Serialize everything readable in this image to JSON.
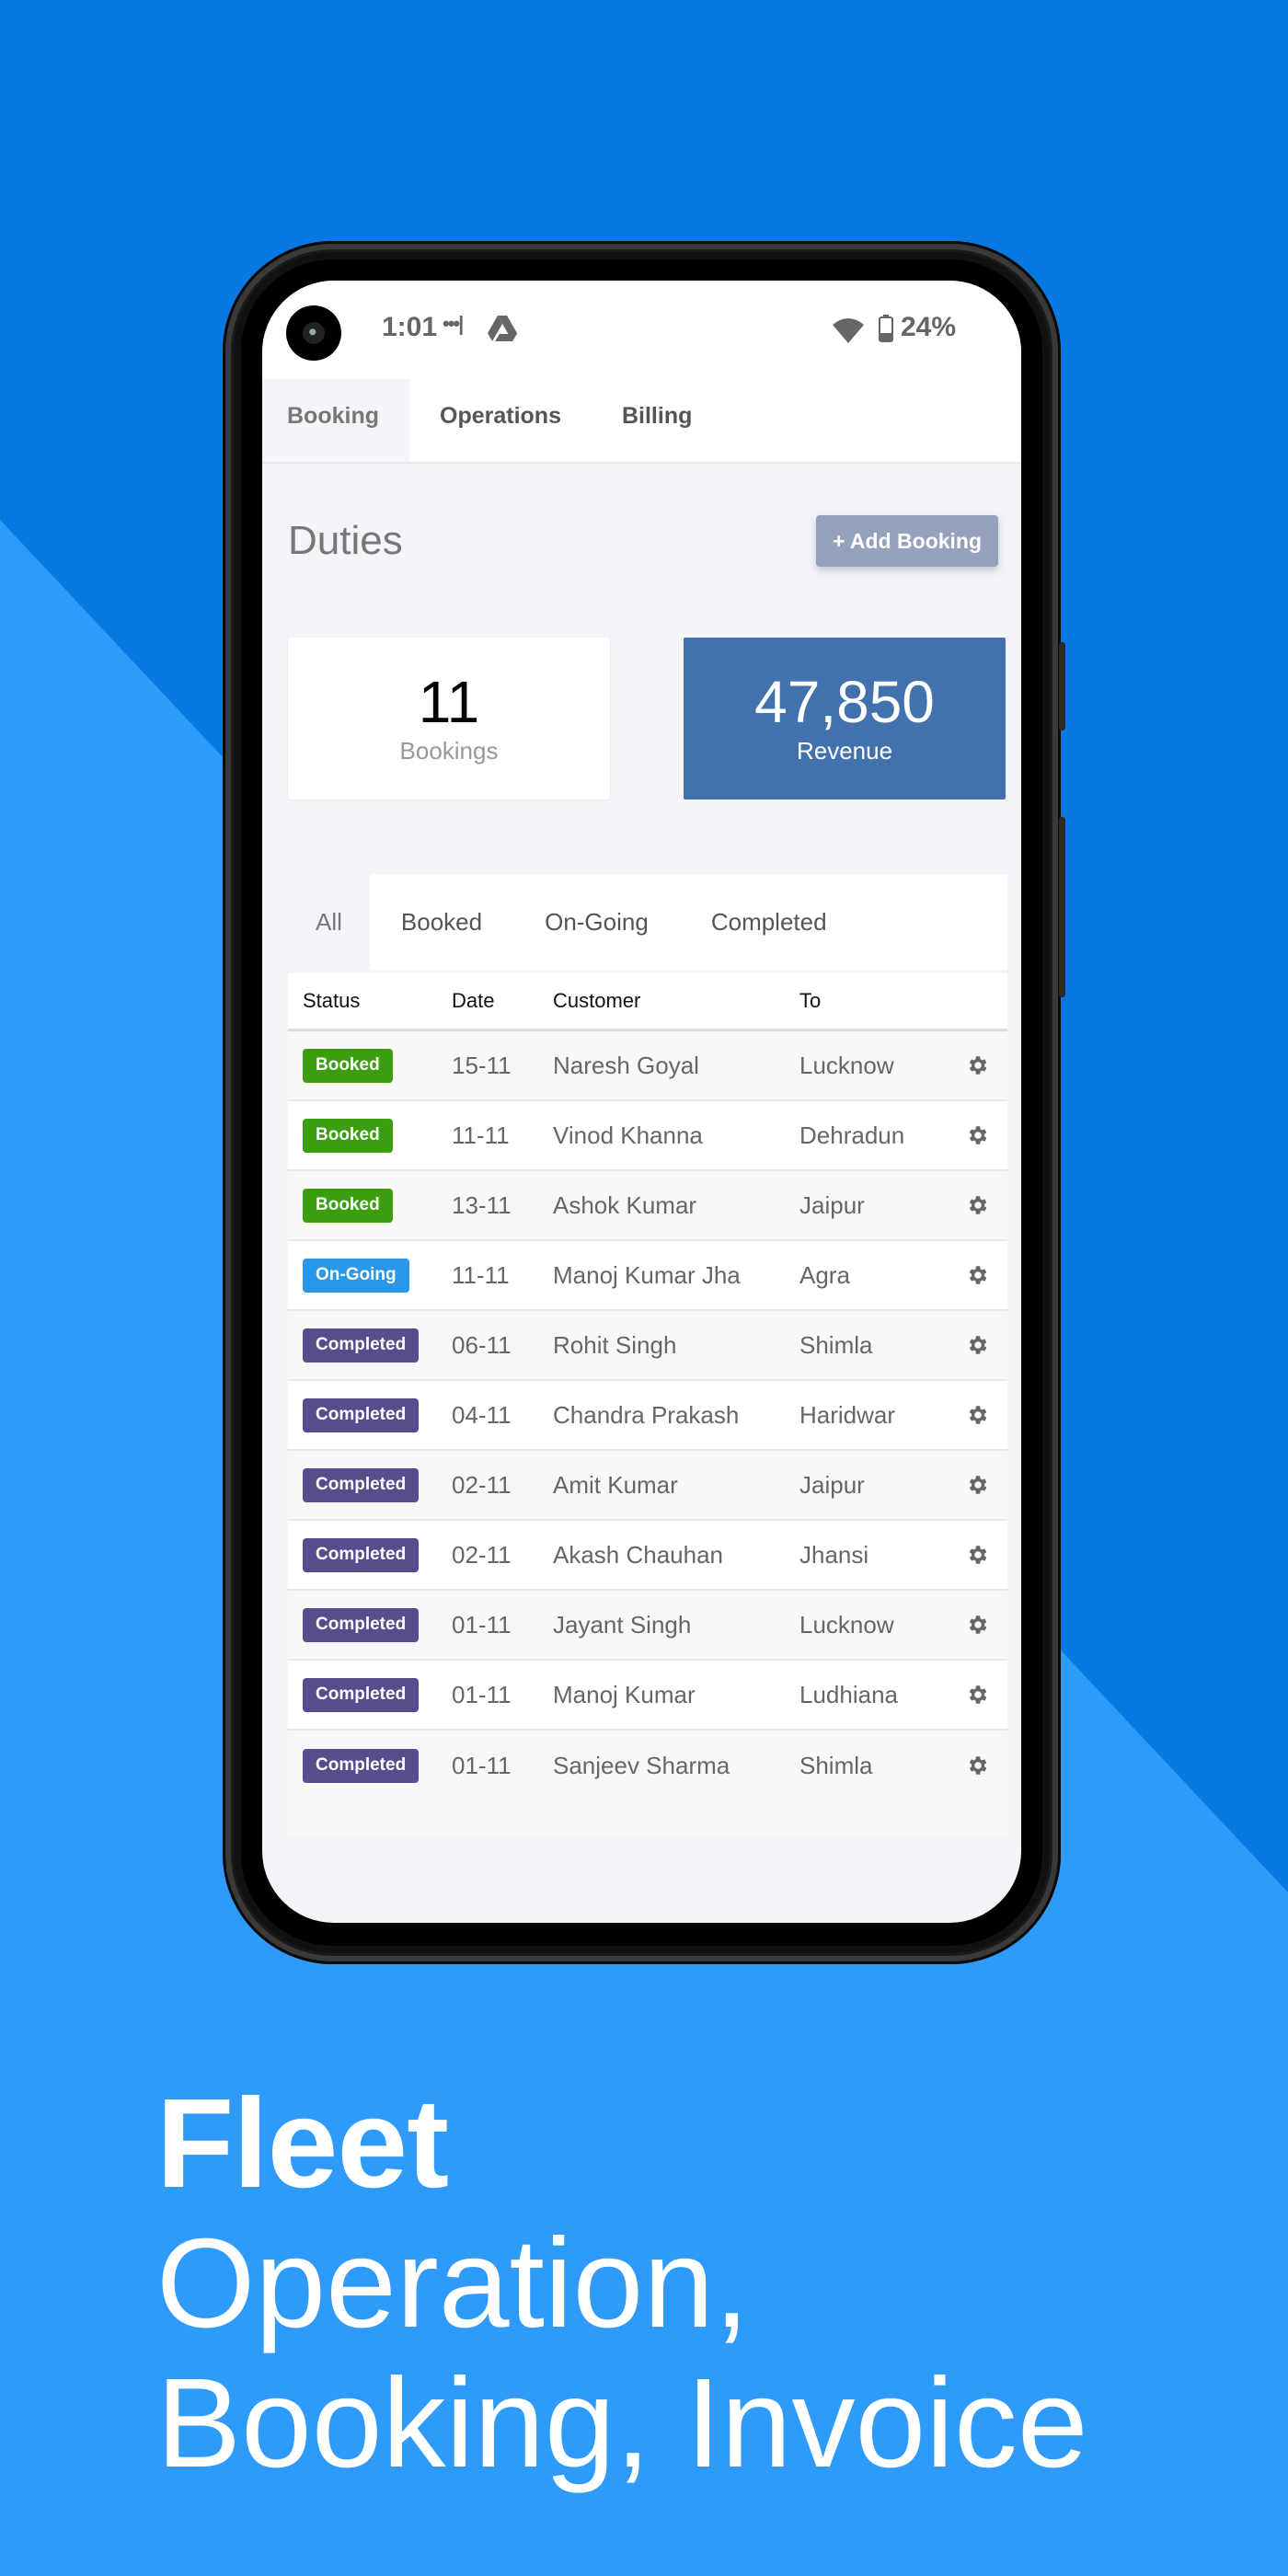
{
  "status_bar": {
    "time": "1:01",
    "notification_dots": "•••|",
    "battery_percent": "24%",
    "icons": [
      "camera-icon",
      "drive-icon",
      "wifi-icon",
      "battery-icon"
    ]
  },
  "top_nav": {
    "tabs": [
      {
        "label": "Booking",
        "active": true
      },
      {
        "label": "Operations",
        "active": false
      },
      {
        "label": "Billing",
        "active": false
      }
    ]
  },
  "page": {
    "title": "Duties",
    "add_button_label": "+ Add Booking"
  },
  "stats": {
    "bookings": {
      "value": "11",
      "label": "Bookings"
    },
    "revenue": {
      "value": "47,850",
      "label": "Revenue"
    }
  },
  "filter_tabs": [
    {
      "label": "All",
      "active": true
    },
    {
      "label": "Booked",
      "active": false
    },
    {
      "label": "On-Going",
      "active": false
    },
    {
      "label": "Completed",
      "active": false
    }
  ],
  "table": {
    "columns": [
      "Status",
      "Date",
      "Customer",
      "To",
      ""
    ],
    "rows": [
      {
        "status": "Booked",
        "date": "15-11",
        "customer": "Naresh Goyal",
        "to": "Lucknow"
      },
      {
        "status": "Booked",
        "date": "11-11",
        "customer": "Vinod Khanna",
        "to": "Dehradun"
      },
      {
        "status": "Booked",
        "date": "13-11",
        "customer": "Ashok Kumar",
        "to": "Jaipur"
      },
      {
        "status": "On-Going",
        "date": "11-11",
        "customer": "Manoj Kumar Jha",
        "to": "Agra"
      },
      {
        "status": "Completed",
        "date": "06-11",
        "customer": "Rohit Singh",
        "to": "Shimla"
      },
      {
        "status": "Completed",
        "date": "04-11",
        "customer": "Chandra Prakash",
        "to": "Haridwar"
      },
      {
        "status": "Completed",
        "date": "02-11",
        "customer": "Amit Kumar",
        "to": "Jaipur"
      },
      {
        "status": "Completed",
        "date": "02-11",
        "customer": "Akash Chauhan",
        "to": "Jhansi"
      },
      {
        "status": "Completed",
        "date": "01-11",
        "customer": "Jayant Singh",
        "to": "Lucknow"
      },
      {
        "status": "Completed",
        "date": "01-11",
        "customer": "Manoj Kumar",
        "to": "Ludhiana"
      },
      {
        "status": "Completed",
        "date": "01-11",
        "customer": "Sanjeev Sharma",
        "to": "Shimla"
      }
    ],
    "row_action_icon": "gear-icon"
  },
  "status_colors": {
    "Booked": "#3A9E0F",
    "On-Going": "#2B97E8",
    "Completed": "#574C8C"
  },
  "theme": {
    "background_dark": "#0779E0",
    "background_light": "#2E9AFA",
    "revenue_card": "#4272AE",
    "add_button": "#96A1BD"
  },
  "tagline": {
    "bold": "Fleet",
    "line1": "Operation,",
    "line2": "Booking, Invoice"
  }
}
